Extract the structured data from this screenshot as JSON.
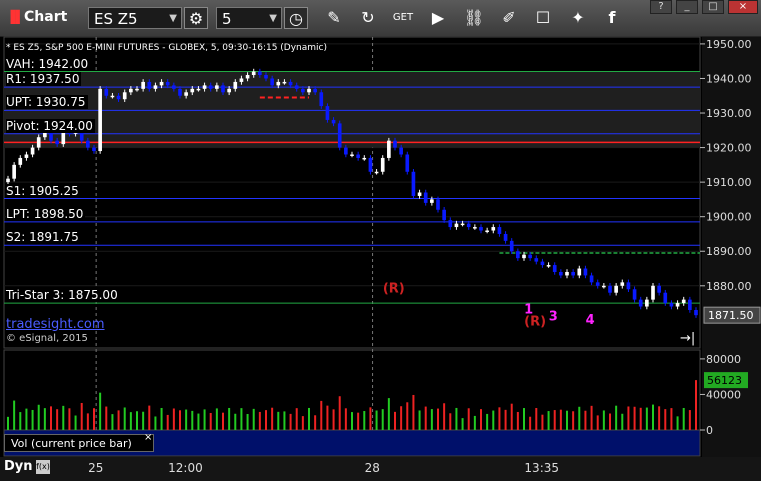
{
  "toolbar": {
    "title": "Chart",
    "symbol": "ES Z5",
    "interval": "5",
    "icons": [
      "gear-icon",
      "clock-icon",
      "pencil-icon",
      "refresh-icon",
      "get-icon",
      "play-icon",
      "link-icon",
      "comment-icon",
      "twitter-icon",
      "facebook-icon"
    ]
  },
  "window_controls": [
    "?",
    "_",
    "□",
    "×"
  ],
  "chart_header": "* ES Z5, S&P 500 E-MINI FUTURES - GLOBEX, 5, 09:30-16:15 (Dynamic)",
  "brand_text": "tradesight.com",
  "copyright": "© eSignal, 2015",
  "footer": {
    "dyn": "Dyn",
    "dyn_icon": "f(x)"
  },
  "colors": {
    "up_candle": "#ffffff",
    "down_candle": "#0a1aff",
    "level_blue": "#2233ff",
    "level_green": "#22aa44",
    "resistance_red": "#ff2222",
    "volume_up": "#22cc22",
    "volume_down": "#ee2222",
    "last_price_badge": "#22aa22"
  },
  "chart_data": [
    {
      "type": "candlestick",
      "price_ticks": [
        1950,
        1940,
        1930,
        1920,
        1910,
        1900,
        1890,
        1880
      ],
      "price_tick_labels": [
        "1950.00",
        "1940.00",
        "1930.00",
        "1920.00",
        "1910.00",
        "1900.00",
        "1890.00",
        "1880.00"
      ],
      "ylim": [
        1862,
        1952
      ],
      "x_tick_labels": [
        "25",
        "12:00",
        "28",
        "13:35"
      ],
      "last_price": "1871.50",
      "levels": [
        {
          "label": "VAH: 1942.00",
          "value": 1942.0
        },
        {
          "label": "R1: 1937.50",
          "value": 1937.5
        },
        {
          "label": "UPT: 1930.75",
          "value": 1930.75
        },
        {
          "label": "Pivot: 1924.00",
          "value": 1924.0
        },
        {
          "label": "S1: 1905.25",
          "value": 1905.25
        },
        {
          "label": "LPT: 1898.50",
          "value": 1898.5
        },
        {
          "label": "S2: 1891.75",
          "value": 1891.75
        },
        {
          "label": "Tri-Star 3: 1875.00",
          "value": 1875.0
        }
      ],
      "annotations": [
        {
          "text": "(R)",
          "x_index": 62,
          "price": 1878.0,
          "color": "#cc2222"
        },
        {
          "text": "(R)",
          "x_index": 85,
          "price": 1868.5,
          "color": "#cc2222"
        },
        {
          "text": "1",
          "x_index": 85,
          "price": 1872.0,
          "color": "#ff22ff"
        },
        {
          "text": "3",
          "x_index": 89,
          "price": 1870.0,
          "color": "#ff22ff"
        },
        {
          "text": "4",
          "x_index": 95,
          "price": 1869.0,
          "color": "#ff22ff"
        }
      ],
      "close": [
        1911,
        1915,
        1917,
        1918,
        1920,
        1923,
        1925,
        1922,
        1921,
        1925,
        1924,
        1925,
        1922,
        1920,
        1919,
        1937,
        1935,
        1935,
        1934,
        1936,
        1937,
        1937,
        1939,
        1937,
        1938,
        1939,
        1938,
        1937,
        1935,
        1936,
        1937,
        1937,
        1938,
        1937,
        1938,
        1936,
        1937,
        1939,
        1940,
        1941,
        1942,
        1941,
        1940,
        1938,
        1939,
        1939,
        1938,
        1937,
        1936,
        1937,
        1936,
        1932,
        1928,
        1927,
        1920,
        1918,
        1918,
        1917,
        1917,
        1913,
        1913,
        1917,
        1922,
        1920,
        1918,
        1913,
        1906,
        1907,
        1904,
        1905,
        1902,
        1899,
        1897,
        1898,
        1898,
        1897,
        1897,
        1896,
        1896,
        1897,
        1895,
        1893,
        1890,
        1888,
        1889,
        1888,
        1887,
        1886,
        1886,
        1884,
        1883,
        1884,
        1883,
        1885,
        1883,
        1881,
        1880,
        1880,
        1878,
        1880,
        1881,
        1879,
        1876,
        1874,
        1876,
        1880,
        1878,
        1875,
        1874,
        1875,
        1876,
        1873,
        1871.5
      ],
      "volume_ticks": [
        0,
        40000,
        80000
      ],
      "volume_tick_labels": [
        "0",
        "40000",
        "80000"
      ],
      "volume_ylim": [
        0,
        90000
      ],
      "last_volume": "56123",
      "volume_label": "Vol (current price bar)"
    }
  ]
}
